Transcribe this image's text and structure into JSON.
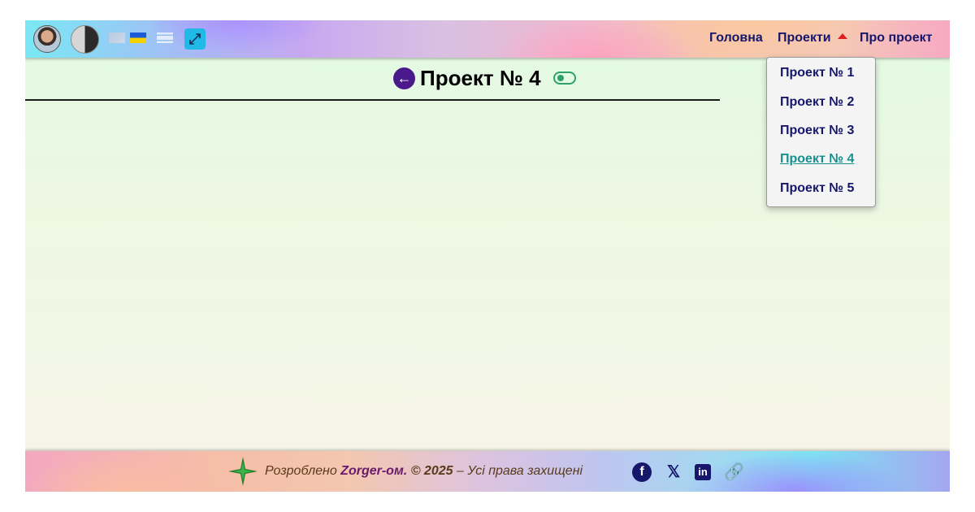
{
  "header": {
    "nav": {
      "home": "Головна",
      "projects": "Проекти",
      "about": "Про проект"
    },
    "icons": [
      "avatar",
      "yin-yang-icon",
      "flag-gb-icon",
      "flag-ua-icon",
      "flag-il-icon",
      "expand-icon"
    ]
  },
  "dropdown": {
    "items": [
      {
        "label": "Проект № 1"
      },
      {
        "label": "Проект № 2"
      },
      {
        "label": "Проект № 3"
      },
      {
        "label": "Проект № 4",
        "active": true
      },
      {
        "label": "Проект № 5"
      }
    ]
  },
  "main": {
    "title": "Проект № 4",
    "icons": [
      "back-arrow-icon",
      "toggle-icon"
    ]
  },
  "footer": {
    "prefix": "Розроблено",
    "brand": "Zorger-ом.",
    "copyright": "© 2025",
    "rights": "– Усі права захищені",
    "social": [
      "facebook-icon",
      "x-icon",
      "linkedin-icon",
      "link-icon"
    ]
  },
  "colors": {
    "nav_text": "#16166b",
    "active_link": "#18908f",
    "back_button": "#4a1a8c",
    "toggle": "#2aa36a"
  }
}
